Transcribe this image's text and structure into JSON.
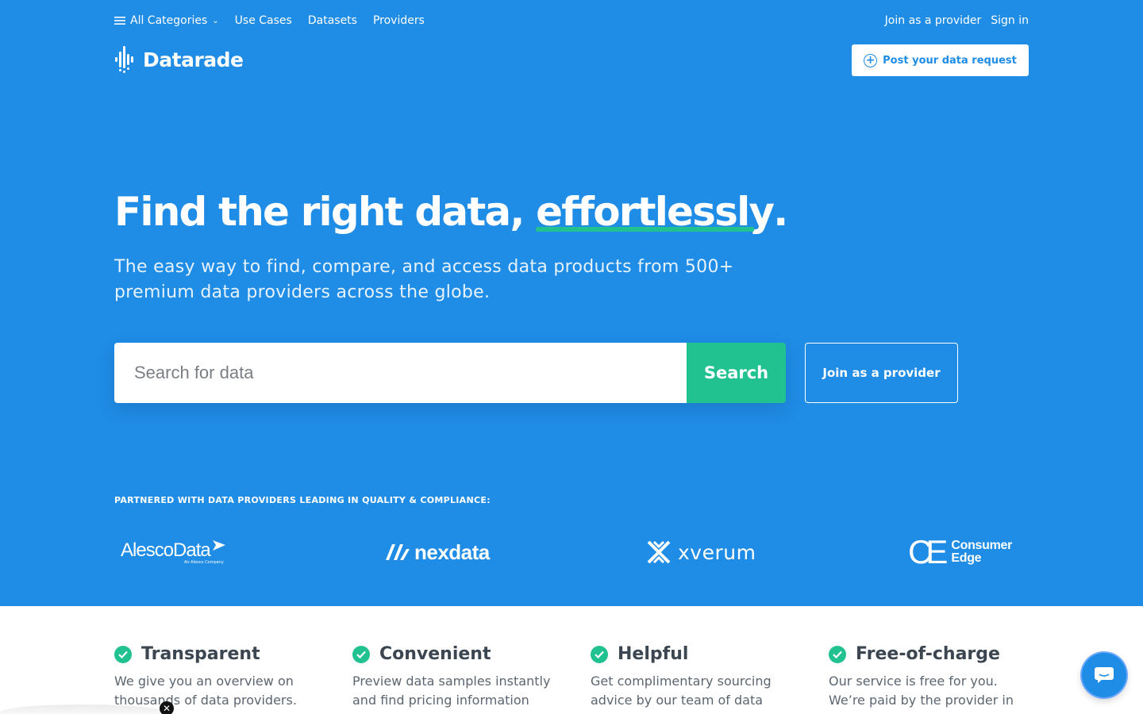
{
  "nav": {
    "all_categories": "All Categories",
    "use_cases": "Use Cases",
    "datasets": "Datasets",
    "providers": "Providers",
    "join_provider": "Join as a provider",
    "sign_in": "Sign in"
  },
  "brand": {
    "name": "Datarade"
  },
  "header": {
    "post_request": "Post your data request"
  },
  "hero": {
    "headline_plain": "Find the right data, ",
    "headline_em": "effortlessly",
    "headline_end": ".",
    "subtitle": "The easy way to find, compare, and access data products from 500+ premium data providers across the globe."
  },
  "search": {
    "placeholder": "Search for data",
    "button": "Search",
    "join_button": "Join as a provider"
  },
  "partners": {
    "heading": "PARTNERED WITH DATA PROVIDERS LEADING IN QUALITY & COMPLIANCE:",
    "alesco": "AlescoData",
    "alesco_tag": "An Alesco Company",
    "nexdata": "nexdata",
    "xverum": "xverum",
    "ce_mark": "CE",
    "ce_line1": "Consumer",
    "ce_line2": "Edge"
  },
  "features": [
    {
      "title": "Transparent",
      "desc": "We give you an overview on thousands of data providers."
    },
    {
      "title": "Convenient",
      "desc": "Preview data samples instantly and find pricing information that"
    },
    {
      "title": "Helpful",
      "desc": "Get complimentary sourcing advice by our team of data"
    },
    {
      "title": "Free-of-charge",
      "desc": "Our service is free for you. We’re paid by the provider in case you"
    }
  ],
  "colors": {
    "hero_bg": "#1f8ce6",
    "accent_green": "#21c190",
    "text_dark": "#3b4650"
  },
  "icons": {
    "menu": "hamburger-icon",
    "chevron": "chevron-down-icon",
    "plus": "plus-circle-icon",
    "check": "check-circle-icon",
    "chat": "chat-bubble-icon",
    "close": "close-icon"
  }
}
